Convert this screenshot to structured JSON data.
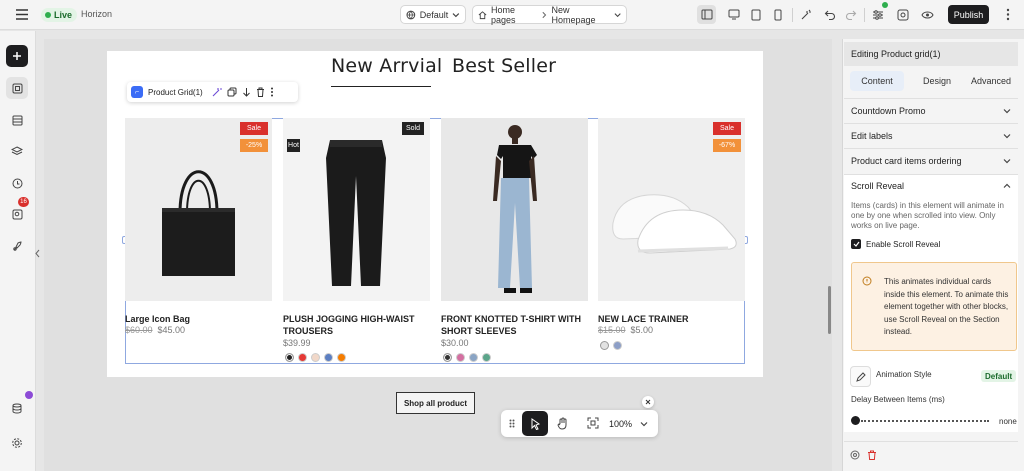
{
  "topbar": {
    "live_label": "Live",
    "theme_name": "Horizon",
    "breakpoint": "Default",
    "breadcrumb_root": "Home pages",
    "breadcrumb_page": "New Homepage",
    "publish_label": "Publish"
  },
  "leftrail": {
    "notification_count": "16"
  },
  "canvas": {
    "tabs": [
      "New Arrvial",
      "Best Seller"
    ],
    "grid_toolbar_label": "Product Grid(1)",
    "products": [
      {
        "name": "Large Icon Bag",
        "old_price": "$60.00",
        "price": "$45.00",
        "tags": [
          "Sale",
          "-25%"
        ],
        "swatches": []
      },
      {
        "name": "PLUSH JOGGING HIGH-WAIST TROUSERS",
        "old_price": "",
        "price": "$39.99",
        "tags": [
          "Sold",
          "Hot"
        ],
        "swatches": [
          "#222222",
          "#e53935",
          "#f1d8c9",
          "#5c7fc2",
          "#f57c00"
        ]
      },
      {
        "name": "FRONT KNOTTED T-SHIRT WITH SHORT SLEEVES",
        "old_price": "",
        "price": "$30.00",
        "tags": [],
        "swatches": [
          "#333333",
          "#d46fa1",
          "#8aa4c4",
          "#5ba58a"
        ]
      },
      {
        "name": "NEW LACE TRAINER",
        "old_price": "$15.00",
        "price": "$5.00",
        "tags": [
          "Sale",
          "-67%"
        ],
        "swatches": [
          "#e2e2e2",
          "#8d9fc7"
        ]
      }
    ],
    "shop_all_label": "Shop all product",
    "zoom": "100%"
  },
  "panel": {
    "header": "Editing Product grid(1)",
    "tabs": [
      "Content",
      "Design",
      "Advanced"
    ],
    "sections": [
      "Countdown Promo",
      "Edit labels",
      "Product card items ordering",
      "Scroll Reveal"
    ],
    "scroll_reveal_desc": "Items (cards) in this element will animate in one by one when scrolled into view. Only works on live page.",
    "enable_label": "Enable Scroll Reveal",
    "note_text": "This animates individual cards inside this element. To animate this element together with other blocks, use Scroll Reveal on the Section instead.",
    "animation_style_label": "Animation Style",
    "animation_style_value": "Default",
    "delay_label": "Delay Between Items (ms)",
    "delay_value": "none"
  },
  "colors": {
    "sale": "#d9302c",
    "discount": "#f2913a",
    "sold": "#222222",
    "accent": "#3b6cf6",
    "live": "#2fae4e"
  }
}
